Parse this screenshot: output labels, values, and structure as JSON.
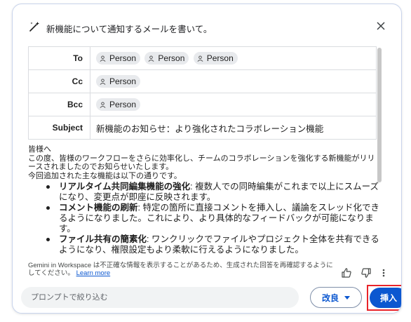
{
  "header": {
    "title": "新機能について通知するメールを書いて。",
    "icon": "magic-wand-icon",
    "close_icon": "close-icon"
  },
  "fields": {
    "to": {
      "label": "To",
      "recipients": [
        "Person",
        "Person",
        "Person"
      ]
    },
    "cc": {
      "label": "Cc",
      "recipients": [
        "Person"
      ]
    },
    "bcc": {
      "label": "Bcc",
      "recipients": [
        "Person"
      ]
    },
    "subject": {
      "label": "Subject",
      "value": "新機能のお知らせ：より強化されたコラボレーション機能"
    }
  },
  "body": {
    "greeting": "皆様へ",
    "intro": "この度、皆様のワークフローをさらに効率化し、チームのコラボレーションを強化する新機能がリリースされましたのでお知らせいたします。",
    "lead": "今回追加された主な機能は以下の通りです。",
    "bullets": [
      {
        "title": "リアルタイム共同編集機能の強化",
        "text": ": 複数人での同時編集がこれまで以上にスムーズになり、変更点が即座に反映されます。"
      },
      {
        "title": "コメント機能の刷新",
        "text": ": 特定の箇所に直接コメントを挿入し、議論をスレッド化できるようになりました。これにより、より具体的なフィードバックが可能になります。"
      },
      {
        "title": "ファイル共有の簡素化",
        "text": ": ワンクリックでファイルやプロジェクト全体を共有できるようになり、権限設定もより柔軟に行えるようになりました。"
      }
    ]
  },
  "footer": {
    "disclaimer": "Gemini in Workspace は不正確な情報を表示することがあるため、生成された回答を再確認するようにしてください。",
    "learn_more": "Learn more",
    "thumbs_up_icon": "thumbs-up-icon",
    "thumbs_down_icon": "thumbs-down-icon",
    "more_icon": "more-vert-icon",
    "prompt_placeholder": "プロンプトで絞り込む",
    "refine_label": "改良",
    "insert_label": "挿入"
  },
  "colors": {
    "accent": "#0b57d0",
    "highlight_outline": "#e8232a",
    "chip_bg": "#e8eaed",
    "border": "#dadce0"
  }
}
